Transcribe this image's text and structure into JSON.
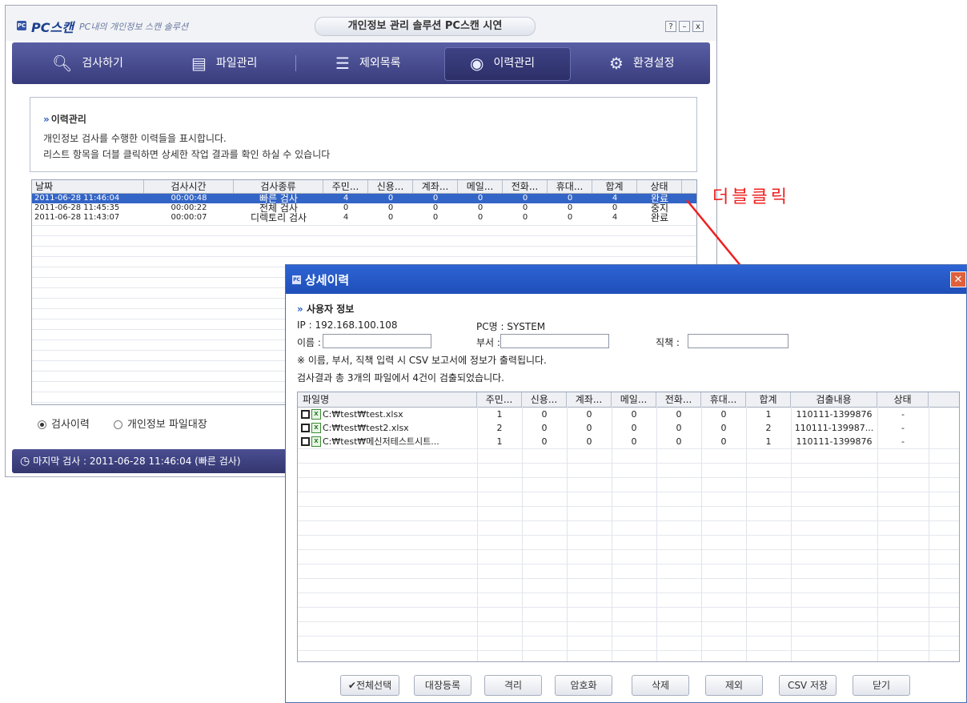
{
  "app": {
    "brand": "PC스캔",
    "brand_sub": "PC내의 개인정보 스캔 솔루션",
    "caption": "개인정보 관리 솔루션 PC스캔 시연",
    "window_buttons": [
      "?",
      "–",
      "x"
    ],
    "nav": [
      {
        "label": "검사하기",
        "icon": "search-icon"
      },
      {
        "label": "파일관리",
        "icon": "file-icon"
      },
      {
        "label": "제외목록",
        "icon": "list-icon"
      },
      {
        "label": "이력관리",
        "icon": "eye-icon",
        "active": true
      },
      {
        "label": "환경설정",
        "icon": "gear-icon"
      }
    ]
  },
  "info": {
    "title": "이력관리",
    "line1": "개인정보 검사를 수행한 이력들을 표시합니다.",
    "line2": "리스트 항목을 더블 클릭하면 상세한 작업 결과를 확인 하실 수 있습니다"
  },
  "history": {
    "columns": [
      "날짜",
      "검사시간",
      "검사종류",
      "주민...",
      "신용...",
      "계좌...",
      "메일...",
      "전화...",
      "휴대...",
      "합계",
      "상태"
    ],
    "rows": [
      [
        "2011-06-28 11:46:04",
        "00:00:48",
        "빠른 검사",
        "4",
        "0",
        "0",
        "0",
        "0",
        "0",
        "4",
        "완료"
      ],
      [
        "2011-06-28 11:45:35",
        "00:00:22",
        "전체 검사",
        "0",
        "0",
        "0",
        "0",
        "0",
        "0",
        "0",
        "중지"
      ],
      [
        "2011-06-28 11:43:07",
        "00:00:07",
        "디렉토리 검사",
        "4",
        "0",
        "0",
        "0",
        "0",
        "0",
        "4",
        "완료"
      ]
    ]
  },
  "radios": {
    "history": "검사이력",
    "ledger": "개인정보 파일대장"
  },
  "status": "마지막 검사 : 2011-06-28 11:46:04 (빠른 검사)",
  "annotation": "더블클릭",
  "dialog": {
    "title": "상세이력",
    "user_section": "사용자 정보",
    "ip": "IP : 192.168.100.108",
    "pc": "PC명 : SYSTEM",
    "name_label": "이름 :",
    "dept_label": "부서 :",
    "position_label": "직책 :",
    "notice": "※ 이름, 부서, 직책 입력 시 CSV 보고서에 정보가 출력됩니다.",
    "summary": "검사결과 총 3개의 파일에서 4건이 검출되었습니다.",
    "columns": [
      "파일명",
      "주민...",
      "신용...",
      "계좌...",
      "메일...",
      "전화...",
      "휴대...",
      "합계",
      "검출내용",
      "상태"
    ],
    "rows": [
      [
        "C:\\test\\test.xlsx",
        "1",
        "0",
        "0",
        "0",
        "0",
        "0",
        "1",
        "110111-1399876",
        "-"
      ],
      [
        "C:\\test\\test2.xlsx",
        "2",
        "0",
        "0",
        "0",
        "0",
        "0",
        "2",
        "110111-139987...",
        "-"
      ],
      [
        "C:\\test\\메신저테스트시트...",
        "1",
        "0",
        "0",
        "0",
        "0",
        "0",
        "1",
        "110111-1399876",
        "-"
      ]
    ],
    "buttons": [
      "✔전체선택",
      "대장등록",
      "격리",
      "암호화",
      "삭제",
      "제외",
      "CSV 저장",
      "닫기"
    ]
  }
}
